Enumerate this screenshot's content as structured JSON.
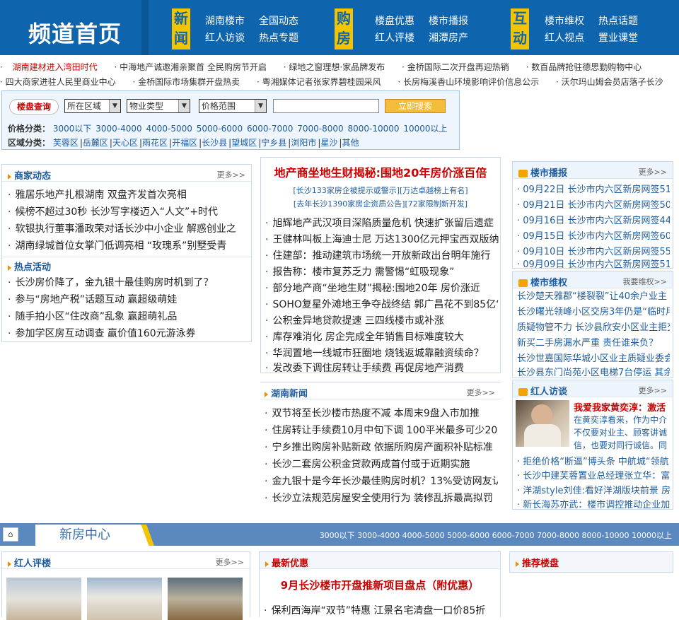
{
  "header": {
    "logo": "频道首页",
    "sections": [
      {
        "title1": "新",
        "title2": "闻",
        "links": [
          "湖南楼市",
          "全国动态",
          "红人访谈",
          "热点专题"
        ]
      },
      {
        "title1": "购",
        "title2": "房",
        "links": [
          "楼盘优惠",
          "楼市播报",
          "红人评楼",
          "湘潭房产"
        ]
      },
      {
        "title1": "互",
        "title2": "动",
        "links": [
          "楼市维权",
          "热点话题",
          "红人视点",
          "置业课堂"
        ]
      }
    ]
  },
  "ticker": {
    "row1": [
      "湖南建材进入湾田时代",
      "中海地产诚邀湘亲聚首 全民购房节开启",
      "绿地之窗理想·家品牌发布",
      "金桥国际二次开盘再迎热销",
      "数百品牌抢驻德思勤购物中心"
    ],
    "row2": [
      "四大商家进驻人民里商业中心",
      "金桥国际市场集群开盘热卖",
      "粤湘媒体记者张家界碧桂园采风",
      "长房梅溪香山环境影响评价信息公示",
      "沃尔玛山姆会员店落子长沙"
    ]
  },
  "search": {
    "badge": "楼盘查询",
    "select1": "所在区域",
    "select2": "物业类型",
    "select3": "价格范围",
    "button": "立即搜索",
    "price_label": "价格分类：",
    "prices": [
      "3000以下",
      "3000-4000",
      "4000-5000",
      "5000-6000",
      "6000-7000",
      "7000-8000",
      "8000-10000",
      "10000以上"
    ],
    "region_label": "区域分类：",
    "regions": [
      "芙蓉区",
      "岳麓区",
      "天心区",
      "雨花区",
      "开福区",
      "长沙县",
      "望城区",
      "宁乡县",
      "浏阳市",
      "星沙",
      "其他"
    ]
  },
  "merchant": {
    "title": "商家动态",
    "more": "更多>>",
    "items": [
      "雅居乐地产扎根湖南 双盘齐发首次亮相",
      "候榜不超过30秒 长沙写字楼迈入“人文”+时代",
      "软银执行董事潘政荣对话长沙中小企业 解惑创业之",
      "湖南绿城首位女掌门低调亮相 “玫瑰系”别墅受青"
    ]
  },
  "hot_activity": {
    "title": "热点活动",
    "items": [
      "长沙房价降了，金九银十最佳购房时机到了？",
      "参与“房地产税”话题互动 赢超级萌娃",
      "随手拍小区“住改商”乱象 赢超萌礼品",
      "参加学区房互动调查 赢价值160元游泳券"
    ]
  },
  "headline": {
    "title": "地产商坐地生财揭秘:围地20年房价涨百倍",
    "sub1": "[长沙133家房企被提示或警示][万达卓越榜上有名]",
    "sub2": "[去年长沙1390家房企资质公告][72家限制新开发]",
    "items": [
      "旭辉地产武汉项目深陷质量危机 快速扩张留后遗症",
      "王健林叫板上海迪士尼 万达1300亿元押宝西双版纳",
      "住建部：推动建筑市场统一开放新政出台明年施行",
      "报告称：楼市复苏乏力 需警惕“虹吸现象”",
      "部分地产商“坐地生财”揭秘:围地20年 房价涨近",
      "SOHO复星外滩地王争夺战终结 郭广昌花不到85亿“",
      "公积金异地贷款提速 三四线楼市或补涨",
      "库存难消化 房企完成全年销售目标难度较大",
      "华润置地一线城市狂圈地 烧钱返城靠融资续命？",
      "发改委下调住房转让手续费 再促房地产消费"
    ]
  },
  "hunan_news": {
    "title": "湖南新闻",
    "more": "更多>>",
    "items": [
      "双节将至长沙楼市热度不减 本周末9盘入市加推",
      "住房转让手续费10月中旬下调 100平米最多可少20",
      "宁乡推出购房补贴新政 依据所购房产面积补贴标准",
      "长沙二套房公积金贷款两成首付或于近期实施",
      "金九银十是今年长沙最佳购房时机？13%受访网友认",
      "长沙立法规范房屋安全使用行为 装修乱拆最高拟罚"
    ]
  },
  "broadcast": {
    "title": "楼市播报",
    "more": "更多>>",
    "items": [
      {
        "date": "09月22日",
        "text": "长沙市内六区新房网签515套"
      },
      {
        "date": "09月21日",
        "text": "长沙市内六区新房网签506套"
      },
      {
        "date": "09月16日",
        "text": "长沙市内六区新房网签445套"
      },
      {
        "date": "09月15日",
        "text": "长沙市内六区新房网签604套"
      },
      {
        "date": "09月10日",
        "text": "长沙市内六区新房网签552套"
      },
      {
        "date": "09月09日",
        "text": "长沙市内六区新房网签517套"
      }
    ]
  },
  "rights": {
    "title": "楼市维权",
    "more": "我要维权>>",
    "items": [
      "长沙楚天雅郡“楼裂裂”让40余户业主",
      "长沙曙光领峰小区交房3年仍是“临时用",
      "质疑物管不力 长沙县欣安小区业主拒交",
      "新买二手房漏水严重 责任谁来负？",
      "长沙世嘉国际华城小区业主质疑业委会",
      "长沙县东门尚苑小区电梯7台停运 其余"
    ]
  },
  "interview": {
    "title": "红人访谈",
    "more": "更多>>",
    "headline": "我爱我家黄奕淳：激活",
    "body": "在黄奕淳看来，作为中介不仅要对业主、顾客讲诚信，也要对同行诚信。同",
    "items": [
      "拒绝价格“断逼”博头条 中航城“领航",
      "长沙中建芙蓉置业总经理张立华：富户",
      "洋湖style刘佳:看好洋湖版块前景 房价",
      "新长海苏亦武：楼市调控推动企业加快"
    ]
  },
  "xinfang": {
    "home": "⌂",
    "title": "新房中心",
    "prices": [
      "3000以下",
      "3000-4000",
      "4000-5000",
      "5000-6000",
      "6000-7000",
      "7000-8000",
      "8000-10000",
      "10000以上"
    ]
  },
  "red_review": {
    "title": "红人评楼",
    "more": "更多>>"
  },
  "latest_offers": {
    "title": "最新优惠",
    "headline": "9月长沙楼市开盘推新项目盘点（附优惠）",
    "items": [
      "保利西海岸“双节”特惠 江景名宅清盘一口价85折"
    ]
  },
  "recommended": {
    "title": "推荐楼盘"
  }
}
